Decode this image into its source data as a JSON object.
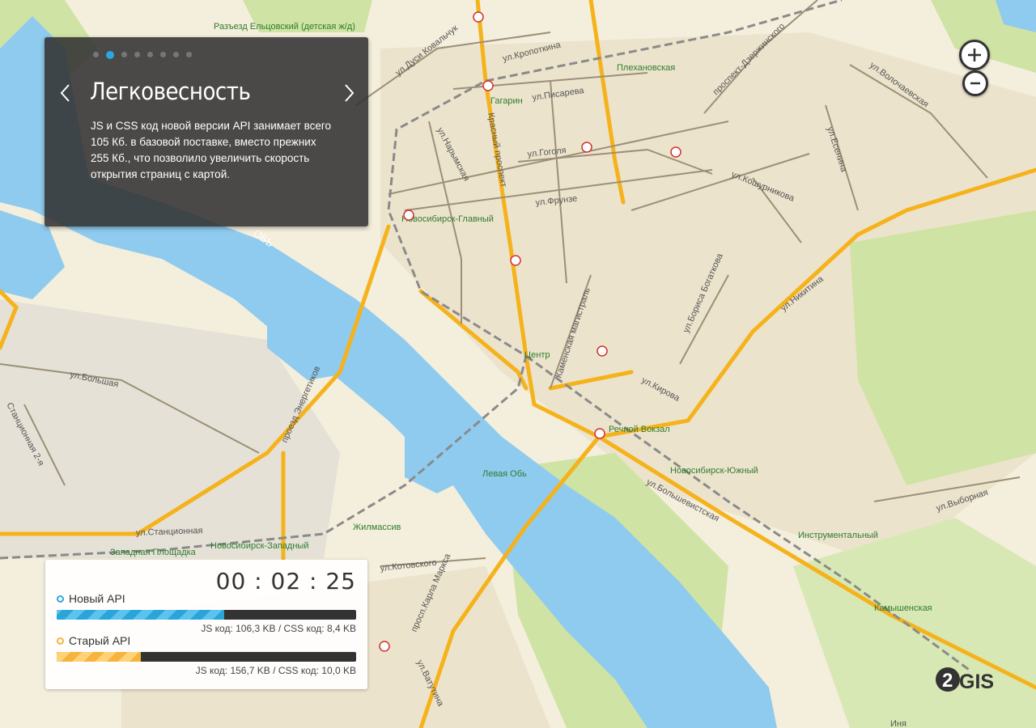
{
  "map": {
    "streets": [
      "ул.Дуси Ковальчук",
      "ул.Кропоткина",
      "ул.Писарева",
      "проспект-Дзержинского",
      "ул.Волочаевская",
      "ул.Нарымская",
      "Красный проспект",
      "ул.Гоголя",
      "ул.Есенина",
      "ул.Кошурникова",
      "ул.Фрунзе",
      "ул.Никитина",
      "ул.Бориса Богаткова",
      "Каменская магистраль",
      "ул.Кирова",
      "ул.Большая",
      "Станционная 2-я",
      "проезд Энергетиков",
      "ул.Станционная",
      "ул.Котовского",
      "просп.Карла Маркса",
      "ул.Ватутина",
      "ул.Большевистская",
      "ул.Выборная",
      "Обь",
      "Иня"
    ],
    "stations": [
      "Разъезд Ельцовский (детская ж/д)",
      "Плехановская",
      "Гагарин...",
      "Новосибирск-Главный",
      "Центр",
      "Речной Вокзал",
      "Новосибирск-Южный",
      "Левая Обь",
      "Жилмассив",
      "Западная Площадка",
      "Новосибирск-Западный",
      "Инструментальный",
      "Камышенская"
    ]
  },
  "info_panel": {
    "dots_count": 8,
    "active_dot": 1,
    "title": "Легковесность",
    "body": "JS и CSS код новой версии API занимает всего 105 Кб. в базовой поставке, вместо прежних 255 Кб., что позволило увеличить скорость открытия страниц с картой."
  },
  "zoom": {
    "in_icon": "plus-icon",
    "out_icon": "minus-icon"
  },
  "stats": {
    "timer": "00 : 02 : 25",
    "new_api": {
      "label": "Новый API",
      "color": "#29a8e0",
      "progress": 0.56,
      "sizes": "JS код: 106,3 KB  /  CSS код: 8,4 KB"
    },
    "old_api": {
      "label": "Старый API",
      "color": "#f5b43c",
      "progress": 0.28,
      "sizes": "JS код: 156,7 KB  /  CSS код: 10,0 KB"
    }
  },
  "logo": {
    "text": "GIS",
    "number": "2"
  }
}
